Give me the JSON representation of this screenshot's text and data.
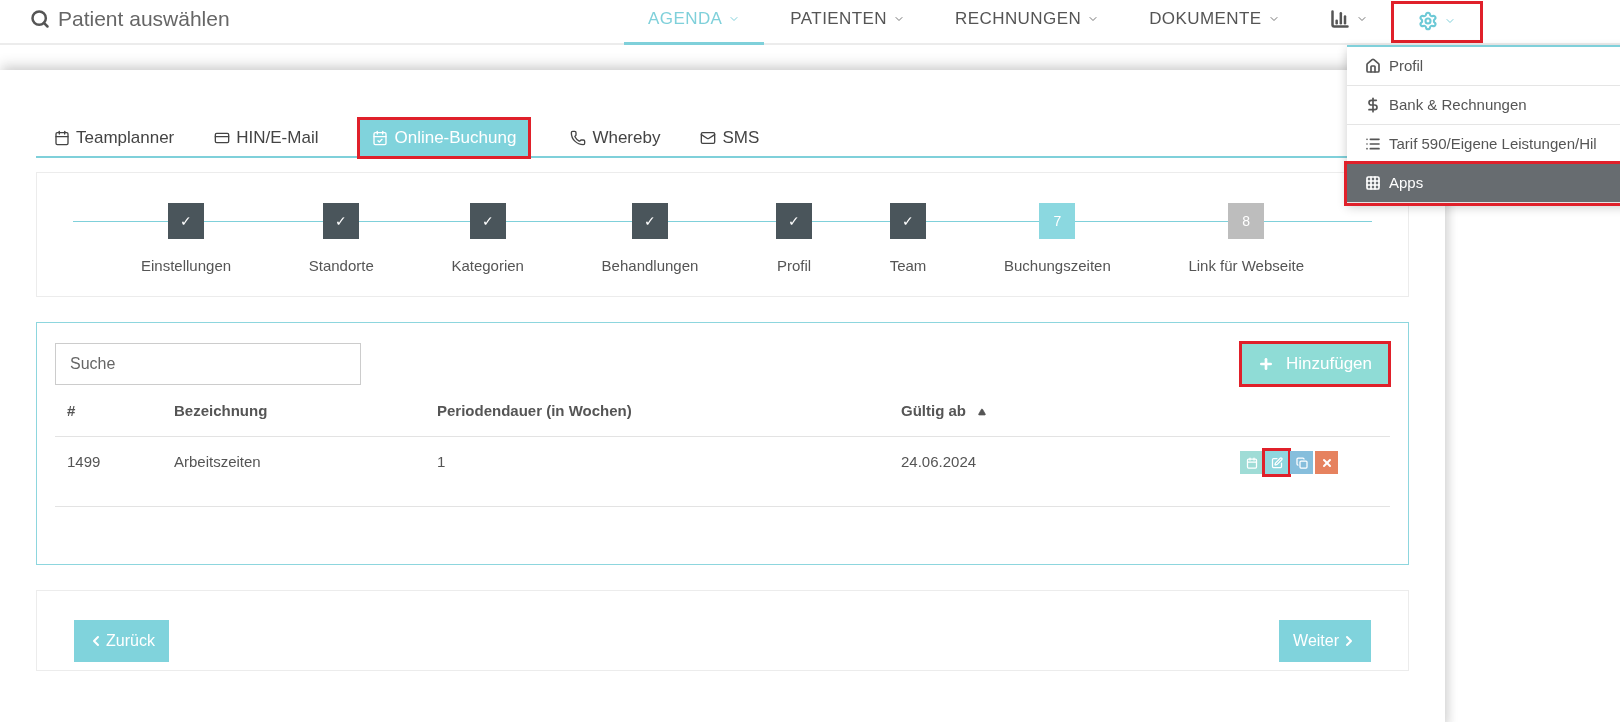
{
  "search": {
    "label": "Patient auswählen"
  },
  "nav": [
    {
      "kind": "text",
      "label": "AGENDA",
      "selected": true,
      "highlighted": false
    },
    {
      "kind": "text",
      "label": "PATIENTEN",
      "selected": false,
      "highlighted": false
    },
    {
      "kind": "text",
      "label": "RECHNUNGEN",
      "selected": false,
      "highlighted": false
    },
    {
      "kind": "text",
      "label": "DOKUMENTE",
      "selected": false,
      "highlighted": false
    },
    {
      "kind": "chart",
      "selected": false,
      "highlighted": false
    },
    {
      "kind": "gear",
      "selected": false,
      "highlighted": true
    }
  ],
  "settings_menu": [
    {
      "kind": "home",
      "label": "Profil",
      "selected": false,
      "highlighted": false
    },
    {
      "kind": "dollar",
      "label": "Bank & Rechnungen",
      "selected": false,
      "highlighted": false
    },
    {
      "kind": "list",
      "label": "Tarif 590/Eigene Leistungen/Hil",
      "selected": false,
      "highlighted": false
    },
    {
      "kind": "apps",
      "label": "Apps",
      "selected": true,
      "highlighted": true
    }
  ],
  "tabs": [
    {
      "kind": "calendar",
      "label": "Teamplanner",
      "selected": false,
      "highlighted": false
    },
    {
      "kind": "card",
      "label": "HIN/E-Mail",
      "selected": false,
      "highlighted": false
    },
    {
      "kind": "calendar-check",
      "label": "Online-Buchung",
      "selected": true,
      "highlighted": true
    },
    {
      "kind": "phone",
      "label": "Whereby",
      "selected": false,
      "highlighted": false
    },
    {
      "kind": "mail",
      "label": "SMS",
      "selected": false,
      "highlighted": false
    }
  ],
  "steps": [
    {
      "kind": "done",
      "mark": "✓",
      "label": "Einstellungen"
    },
    {
      "kind": "done",
      "mark": "✓",
      "label": "Standorte"
    },
    {
      "kind": "done",
      "mark": "✓",
      "label": "Kategorien"
    },
    {
      "kind": "done",
      "mark": "✓",
      "label": "Behandlungen"
    },
    {
      "kind": "done",
      "mark": "✓",
      "label": "Profil"
    },
    {
      "kind": "done",
      "mark": "✓",
      "label": "Team"
    },
    {
      "kind": "current",
      "mark": "7",
      "label": "Buchungszeiten"
    },
    {
      "kind": "pending",
      "mark": "8",
      "label": "Link für Webseite"
    }
  ],
  "table": {
    "search": {
      "placeholder": "Suche"
    },
    "add_button": {
      "label": "Hinzufügen",
      "highlighted": true
    },
    "columns": [
      {
        "label": "#",
        "sorted": false
      },
      {
        "label": "Bezeichnung",
        "sorted": false
      },
      {
        "label": "Periodendauer (in Wochen)",
        "sorted": false
      },
      {
        "label": "Gültig ab",
        "sorted": true
      }
    ],
    "rows": [
      {
        "cells": [
          "1499",
          "Arbeitszeiten",
          "1",
          "24.06.2024"
        ],
        "actions": [
          {
            "kind": "calendar",
            "highlighted": false
          },
          {
            "kind": "edit",
            "highlighted": true
          },
          {
            "kind": "copy",
            "highlighted": false
          },
          {
            "kind": "delete",
            "highlighted": false
          }
        ]
      }
    ]
  },
  "footer": {
    "back": "Zurück",
    "next": "Weiter"
  }
}
